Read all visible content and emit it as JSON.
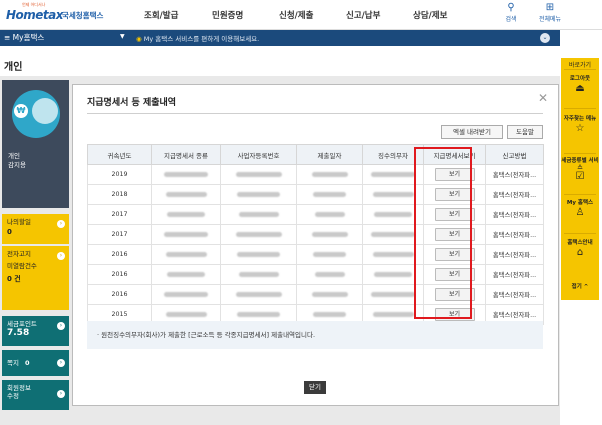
{
  "header": {
    "logo_small": "언제 어디서나",
    "logo_main": "Hometax",
    "logo_sub": "국세청홈택스",
    "nav": [
      "조회/발급",
      "민원증명",
      "신청/제출",
      "신고/납부",
      "상담/제보"
    ],
    "search_label": "검색",
    "allmenu_label": "전체메뉴"
  },
  "bar": {
    "mytax_label": "≡  My홈택스",
    "message": "My 홈택스 서비스를 편하게 이용해보세요."
  },
  "page_title": "개인",
  "hero": {
    "label_line1": "개인",
    "label_line2": "감지용"
  },
  "side": {
    "my_todo": {
      "title": "나의할일",
      "value": "0"
    },
    "notice": {
      "title1": "전자고지",
      "title2": "미열람건수",
      "value": "0 건"
    },
    "points": {
      "title": "세금포인트",
      "value": "7.58"
    },
    "note": {
      "title": "쪽지",
      "value": "0"
    },
    "member": {
      "title1": "회원정보",
      "title2": "수정"
    }
  },
  "modal": {
    "title": "지급명세서 등 제출내역",
    "print_label": "엑셀 내려받기",
    "help_label": "도움말",
    "columns": [
      "귀속년도",
      "지급명세서 종류",
      "사업자등록번호",
      "제출일자",
      "징수의무자",
      "지급명세서보기",
      "신고방법"
    ],
    "rows": [
      {
        "year": "2019",
        "view": "보기",
        "method": "홈택스(전자파..."
      },
      {
        "year": "2018",
        "view": "보기",
        "method": "홈택스(전자파..."
      },
      {
        "year": "2017",
        "view": "보기",
        "method": "홈택스(전자파..."
      },
      {
        "year": "2017",
        "view": "보기",
        "method": "홈택스(전자파..."
      },
      {
        "year": "2016",
        "view": "보기",
        "method": "홈택스(전자파..."
      },
      {
        "year": "2016",
        "view": "보기",
        "method": "홈택스(전자파..."
      },
      {
        "year": "2016",
        "view": "보기",
        "method": "홈택스(전자파..."
      },
      {
        "year": "2015",
        "view": "보기",
        "method": "홈택스(전자파..."
      }
    ],
    "note": "· 원천징수의무자(회사)가 제출한 [근로소득 등 각종지급명세서] 제출내역입니다.",
    "close_label": "닫기"
  },
  "quick": {
    "title": "바로가기",
    "items": [
      {
        "label": "로그아웃",
        "icon": "logout-icon"
      },
      {
        "label": "자주찾는 메뉴",
        "icon": "star-icon"
      },
      {
        "label": "세금종류별 서비스",
        "icon": "check-icon"
      },
      {
        "label": "My 홈택스",
        "icon": "person-icon"
      },
      {
        "label": "홈택스안내",
        "icon": "house-icon"
      }
    ],
    "collapse_label": "접기 ^"
  },
  "colors": {
    "navy": "#1b4a7c",
    "yellow": "#f5c500",
    "teal": "#0f6f74",
    "highlight": "#e0191e"
  }
}
